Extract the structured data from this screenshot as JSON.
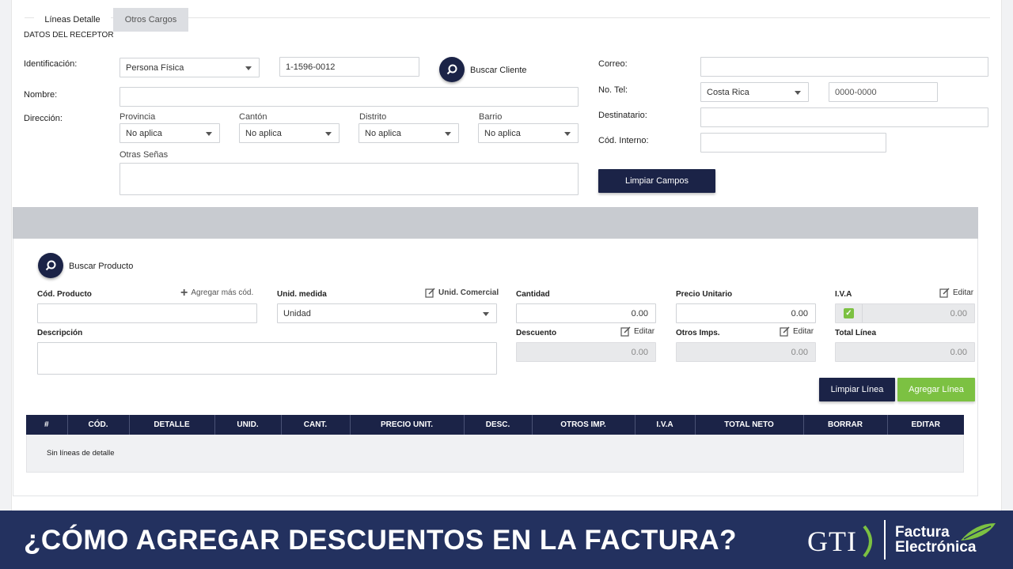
{
  "receptor": {
    "section_title": "DATOS DEL RECEPTOR",
    "identificacion_label": "Identificación:",
    "tipo_id": "Persona Física",
    "numero_id": "1-1596-0012",
    "buscar_cliente": "Buscar Cliente",
    "nombre_label": "Nombre:",
    "direccion_label": "Dirección:",
    "provincia_label": "Provincia",
    "provincia_value": "No aplica",
    "canton_label": "Cantón",
    "canton_value": "No aplica",
    "distrito_label": "Distrito",
    "distrito_value": "No aplica",
    "barrio_label": "Barrio",
    "barrio_value": "No aplica",
    "otras_senas_label": "Otras Señas",
    "correo_label": "Correo:",
    "tel_label": "No. Tel:",
    "pais_value": "Costa Rica",
    "tel_placeholder": "0000-0000",
    "destinatario_label": "Destinatario:",
    "cod_interno_label": "Cód. Interno:",
    "limpiar_campos": "Limpiar Campos"
  },
  "tabs": [
    {
      "label": "Líneas Detalle",
      "active": true
    },
    {
      "label": "Otros Cargos",
      "active": false
    }
  ],
  "detalle": {
    "buscar_producto": "Buscar Producto",
    "cod_producto_label": "Cód. Producto",
    "agregar_mas_cod": "Agregar más cód.",
    "unid_medida_label": "Unid. medida",
    "unid_comercial": "Unid. Comercial",
    "unid_value": "Unidad",
    "cantidad_label": "Cantidad",
    "cantidad_value": "0.00",
    "precio_label": "Precio Unitario",
    "precio_value": "0.00",
    "iva_label": "I.V.A",
    "iva_value": "0.00",
    "editar": "Editar",
    "descripcion_label": "Descripción",
    "descuento_label": "Descuento",
    "descuento_value": "0.00",
    "otros_imps_label": "Otros Imps.",
    "otros_imps_value": "0.00",
    "total_linea_label": "Total Línea",
    "total_linea_value": "0.00",
    "limpiar_linea": "Limpiar Línea",
    "agregar_linea": "Agregar Línea"
  },
  "table": {
    "columns": [
      "#",
      "CÓD.",
      "DETALLE",
      "UNID.",
      "CANT.",
      "PRECIO UNIT.",
      "DESC.",
      "OTROS IMP.",
      "I.V.A",
      "TOTAL NETO",
      "BORRAR",
      "EDITAR"
    ],
    "empty_text": "Sin líneas de detalle"
  },
  "banner": {
    "title": "¿CÓMO AGREGAR DESCUENTOS EN LA FACTURA?",
    "logo_gti": "GTI",
    "logo_fe_line1": "Factura",
    "logo_fe_line2": "Electrónica"
  },
  "colors": {
    "primary": "#1b2347",
    "accent_green": "#7cc142",
    "banner": "#23315f"
  }
}
